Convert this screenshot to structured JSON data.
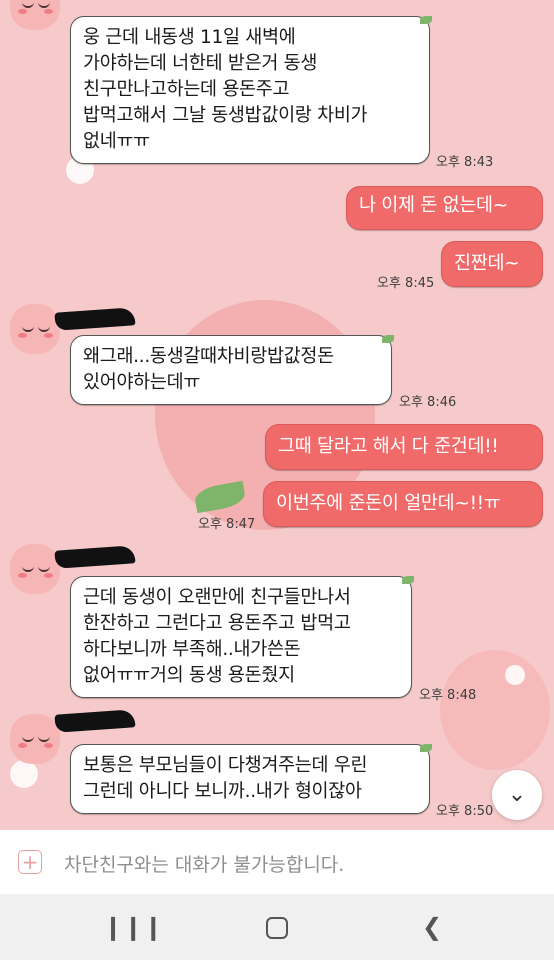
{
  "messages": [
    {
      "side": "them",
      "text": "웅 근데 내동생 11일 새벽에\n가야하는데 너한테 받은거 동생\n친구만나고하는데 용돈주고\n밥먹고해서 그날 동생밥값이랑 차비가\n없네ㅠㅠ",
      "time": "오후 8:43"
    },
    {
      "side": "me",
      "text": "나 이제 돈 없는데~",
      "time": ""
    },
    {
      "side": "me",
      "text": "진짠데~",
      "time": "오후 8:45"
    },
    {
      "side": "them",
      "text": "왜그래...동생갈때차비랑밥값정돈\n있어야하는데ㅠ",
      "time": "오후 8:46"
    },
    {
      "side": "me",
      "text": "그때 달라고 해서 다 준건데!!",
      "time": ""
    },
    {
      "side": "me",
      "text": "이번주에 준돈이 얼만데~!!ㅠ",
      "time": "오후 8:47"
    },
    {
      "side": "them",
      "text": "근데 동생이 오랜만에 친구들만나서\n한잔하고 그런다고 용돈주고 밥먹고\n하다보니까 부족해..내가쓴돈\n없어ㅠㅠ거의 동생 용돈줬지",
      "time": "오후 8:48"
    },
    {
      "side": "them",
      "text": "보통은 부모님들이 다챙겨주는데 우린\n그런데 아니다 보니까..내가 형이잖아",
      "time": "오후 8:50"
    }
  ],
  "input": {
    "placeholder": "차단친구와는 대화가 불가능합니다."
  },
  "icons": {
    "plus": "plus-icon",
    "scroll_down": "chevron-down-icon",
    "nav_recent": "recent-apps-icon",
    "nav_home": "home-icon",
    "nav_back": "back-icon"
  },
  "colors": {
    "background": "#f6caca",
    "my_bubble": "#f06a6a",
    "their_bubble": "#ffffff"
  }
}
